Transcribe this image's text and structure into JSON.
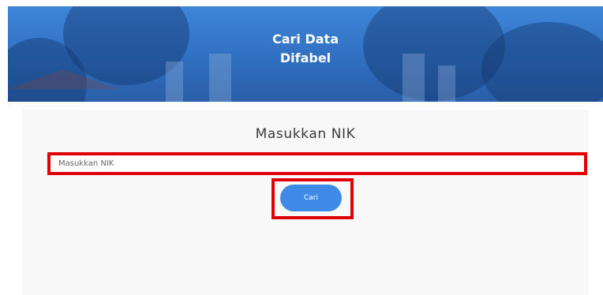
{
  "header": {
    "title_line1": "Cari Data",
    "title_line2": "Difabel"
  },
  "search": {
    "heading": "Masukkan NIK",
    "placeholder": "Masukkan NIK",
    "value": "",
    "button_label": "Cari"
  },
  "colors": {
    "banner": "#3f86d9",
    "button": "#3e8be6",
    "highlight": "#e00000",
    "panel": "#f8f8f8"
  }
}
